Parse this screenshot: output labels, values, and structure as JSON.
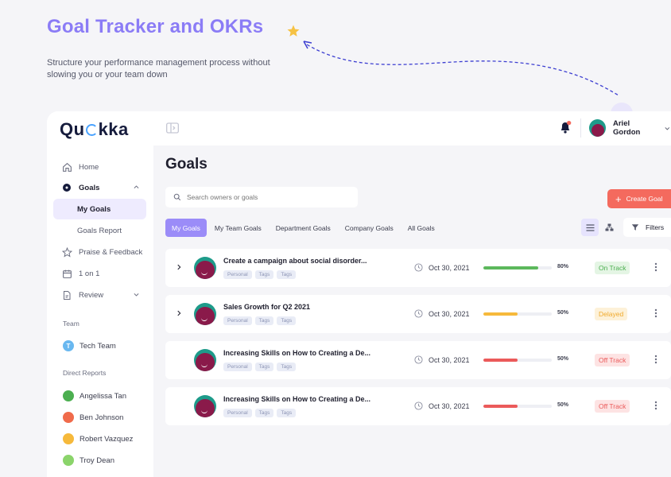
{
  "hero": {
    "title": "Goal Tracker and OKRs",
    "subtitle": "Structure your performance management process without slowing you or your team down"
  },
  "app": {
    "logo": {
      "left": "Qu",
      "right": "kka"
    },
    "sidebar": {
      "items": [
        {
          "label": "Home",
          "icon": "home-icon"
        },
        {
          "label": "Goals",
          "icon": "target-icon"
        },
        {
          "label": "My Goals"
        },
        {
          "label": "Goals Report"
        },
        {
          "label": "Praise & Feedback",
          "icon": "star-icon"
        },
        {
          "label": "1 on 1",
          "icon": "calendar-icon"
        },
        {
          "label": "Review",
          "icon": "document-icon"
        }
      ],
      "team_label": "Team",
      "team": {
        "initial": "T",
        "name": "Tech Team"
      },
      "direct_reports_label": "Direct Reports",
      "direct_reports": [
        "Angelissa Tan",
        "Ben Johnson",
        "Robert Vazquez",
        "Troy Dean"
      ]
    },
    "topbar": {
      "user_name": "Ariel Gordon"
    },
    "page_title": "Goals",
    "search_placeholder": "Search owners or goals",
    "create_label": "Create Goal",
    "tabs": [
      "My Goals",
      "My Team Goals",
      "Department Goals",
      "Company Goals",
      "All Goals"
    ],
    "filters_label": "Filters",
    "goals": [
      {
        "title": "Create a campaign about social disorder...",
        "tags": [
          "Personal",
          "Tags",
          "Tags"
        ],
        "date": "Oct 30, 2021",
        "progress_label": "80%",
        "progress": 0.8,
        "status": "On Track"
      },
      {
        "title": "Sales Growth for Q2 2021",
        "tags": [
          "Personal",
          "Tags",
          "Tags"
        ],
        "date": "Oct 30, 2021",
        "progress_label": "50%",
        "progress": 0.5,
        "status": "Delayed"
      },
      {
        "title": "Increasing Skills on How to Creating a De...",
        "tags": [
          "Personal",
          "Tags",
          "Tags"
        ],
        "date": "Oct 30, 2021",
        "progress_label": "50%",
        "progress": 0.5,
        "status": "Off Track"
      },
      {
        "title": "Increasing Skills on How to Creating a De...",
        "tags": [
          "Personal",
          "Tags",
          "Tags"
        ],
        "date": "Oct 30, 2021",
        "progress_label": "50%",
        "progress": 0.5,
        "status": "Off Track"
      }
    ],
    "colors": {
      "accent": "#9b8cf8",
      "create": "#f46a5e",
      "on_track": "#5cb85c",
      "delayed": "#f6b93b",
      "off_track": "#eb5a5a"
    }
  }
}
